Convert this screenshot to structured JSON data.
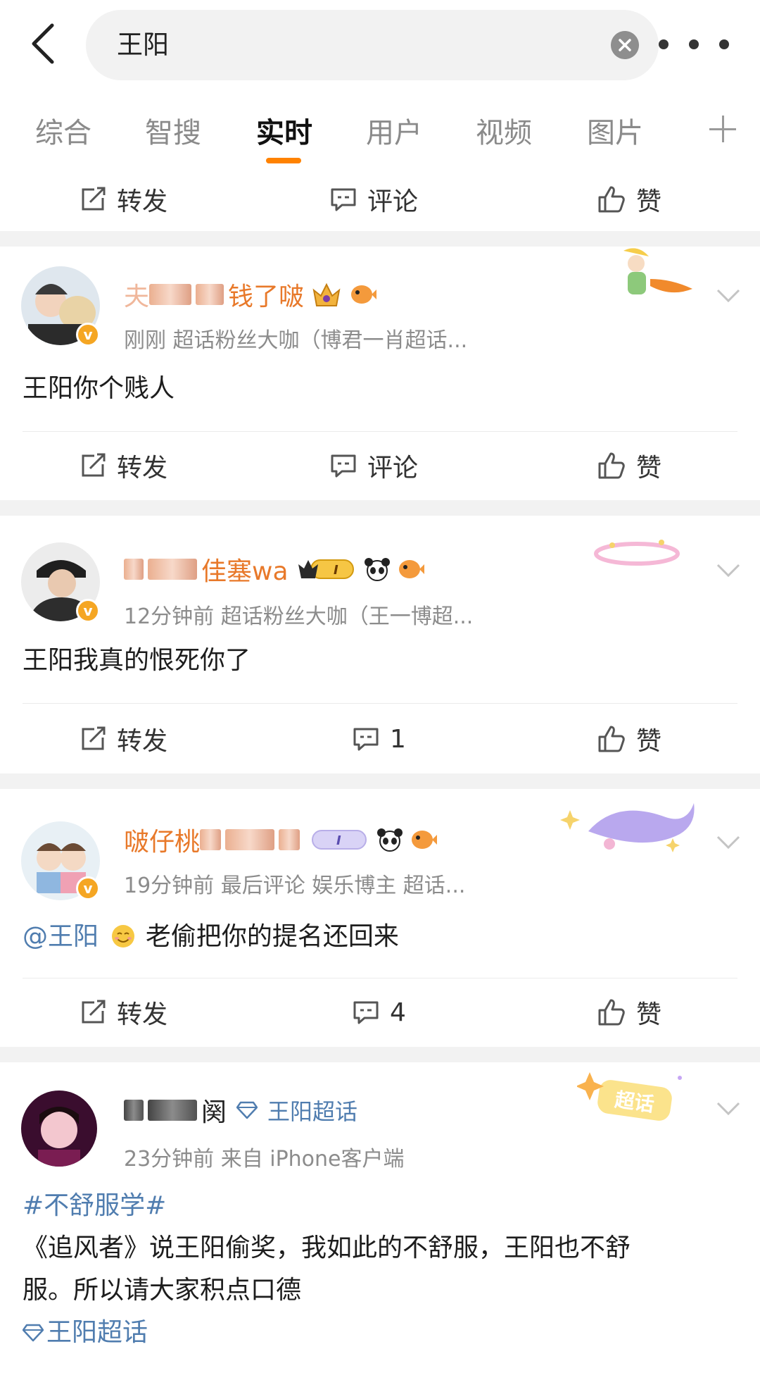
{
  "search": {
    "query": "王阳"
  },
  "tabs": [
    {
      "label": "综合"
    },
    {
      "label": "智搜"
    },
    {
      "label": "实时"
    },
    {
      "label": "用户"
    },
    {
      "label": "视频"
    },
    {
      "label": "图片"
    }
  ],
  "actions": {
    "repost": "转发",
    "comment": "评论",
    "like": "赞"
  },
  "posts": [
    {
      "name_suffix": "钱了啵",
      "meta": "刚刚   超话粉丝大咖（博君一肖超话...",
      "text": "王阳你个贱人"
    },
    {
      "name_suffix": "佳塞wa",
      "meta": "12分钟前   超话粉丝大咖（王一博超...",
      "text": "王阳我真的恨死你了",
      "comment_count": "1"
    },
    {
      "name_prefix": "啵仔桃",
      "meta": "19分钟前  最后评论   娱乐博主  超话...",
      "mention": "@王阳",
      "text": "老偷把你的提名还回来",
      "comment_count": "4"
    },
    {
      "name_suffix": "阕",
      "supertopic": "王阳超话",
      "meta": "23分钟前    来自 iPhone客户端",
      "hashtag": "#不舒服学#",
      "text_line1": "《追风者》说王阳偷奖，我如此的不舒服，王阳也不舒",
      "text_line2": "服。所以请大家积点口德",
      "topic_link": "王阳超话"
    }
  ],
  "colors": {
    "accent": "#ff8200",
    "link": "#507daf",
    "name": "#e8792a"
  }
}
